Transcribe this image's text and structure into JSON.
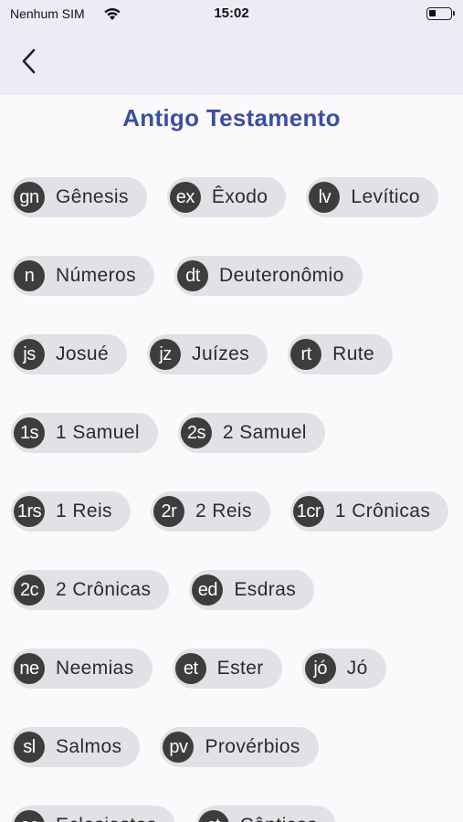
{
  "status_bar": {
    "carrier": "Nenhum SIM",
    "time": "15:02",
    "battery_level": 0.3
  },
  "header": {
    "back_icon": "chevron-left-icon"
  },
  "page": {
    "title": "Antigo Testamento"
  },
  "books": [
    {
      "abbr": "gn",
      "name": "Gênesis"
    },
    {
      "abbr": "ex",
      "name": "Êxodo"
    },
    {
      "abbr": "lv",
      "name": "Levítico"
    },
    {
      "abbr": "n",
      "name": "Números"
    },
    {
      "abbr": "dt",
      "name": "Deuteronômio"
    },
    {
      "abbr": "js",
      "name": "Josué"
    },
    {
      "abbr": "jz",
      "name": "Juízes"
    },
    {
      "abbr": "rt",
      "name": "Rute"
    },
    {
      "abbr": "1s",
      "name": "1 Samuel"
    },
    {
      "abbr": "2s",
      "name": "2 Samuel"
    },
    {
      "abbr": "1rs",
      "name": "1 Reis"
    },
    {
      "abbr": "2r",
      "name": "2 Reis"
    },
    {
      "abbr": "1cr",
      "name": "1 Crônicas"
    },
    {
      "abbr": "2c",
      "name": "2 Crônicas"
    },
    {
      "abbr": "ed",
      "name": "Esdras"
    },
    {
      "abbr": "ne",
      "name": "Neemias"
    },
    {
      "abbr": "et",
      "name": "Ester"
    },
    {
      "abbr": "jó",
      "name": "Jó"
    },
    {
      "abbr": "sl",
      "name": "Salmos"
    },
    {
      "abbr": "pv",
      "name": "Provérbios"
    },
    {
      "abbr": "ec",
      "name": "Eclesiastes"
    },
    {
      "abbr": "ct",
      "name": "Cânticos"
    }
  ],
  "colors": {
    "title": "#3a4fa2",
    "header_bg": "#eeeaf6",
    "chip_bg": "#e3e1e6",
    "avatar_bg": "#3d3d3d"
  }
}
